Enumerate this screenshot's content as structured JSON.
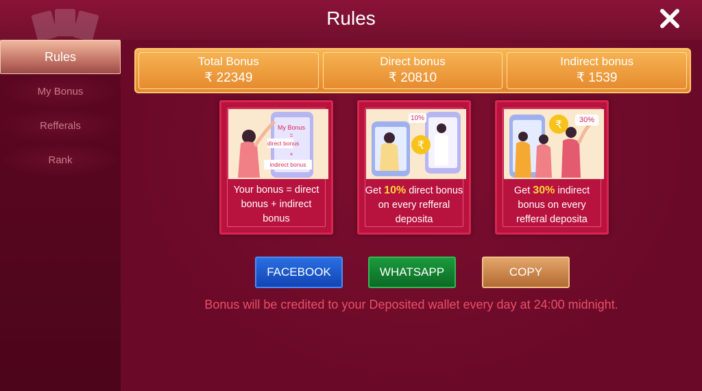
{
  "header": {
    "title": "Rules"
  },
  "sidebar": {
    "items": [
      {
        "label": "Rules",
        "active": true
      },
      {
        "label": "My Bonus",
        "active": false
      },
      {
        "label": "Refferals",
        "active": false
      },
      {
        "label": "Rank",
        "active": false
      }
    ]
  },
  "bonus_summary": {
    "total": {
      "label": "Total Bonus",
      "value": "₹ 22349"
    },
    "direct": {
      "label": "Direct bonus",
      "value": "₹ 20810"
    },
    "indirect": {
      "label": "Indirect bonus",
      "value": "₹ 1539"
    }
  },
  "cards": {
    "formula": {
      "pic_title": "My Bonus",
      "pic_eq": "=",
      "pic_direct": "direct bonus",
      "pic_plus": "+",
      "pic_indirect": "indirect bonus",
      "text": "Your bonus = direct bonus + indirect bonus"
    },
    "direct": {
      "pic_pct": "10%",
      "text_pre": "Get ",
      "text_hl": "10%",
      "text_post": " direct bonus on every refferal deposita"
    },
    "indirect": {
      "pic_pct": "30%",
      "text_pre": "Get ",
      "text_hl": "30%",
      "text_post": " indirect bonus on every refferal deposita"
    }
  },
  "share": {
    "facebook_label": "FACEBOOK",
    "whatsapp_label": "WHATSAPP",
    "copy_label": "COPY"
  },
  "note": "Bonus will be credited to your Deposited wallet every day at 24:00 midnight.",
  "colors": {
    "background": "#6e0a2a",
    "accent_orange": "#f0a040",
    "highlight": "#ffd43a",
    "note_text": "#ea4f66"
  },
  "icons": {
    "close": "close-icon",
    "rupee": "rupee-coin-icon"
  }
}
